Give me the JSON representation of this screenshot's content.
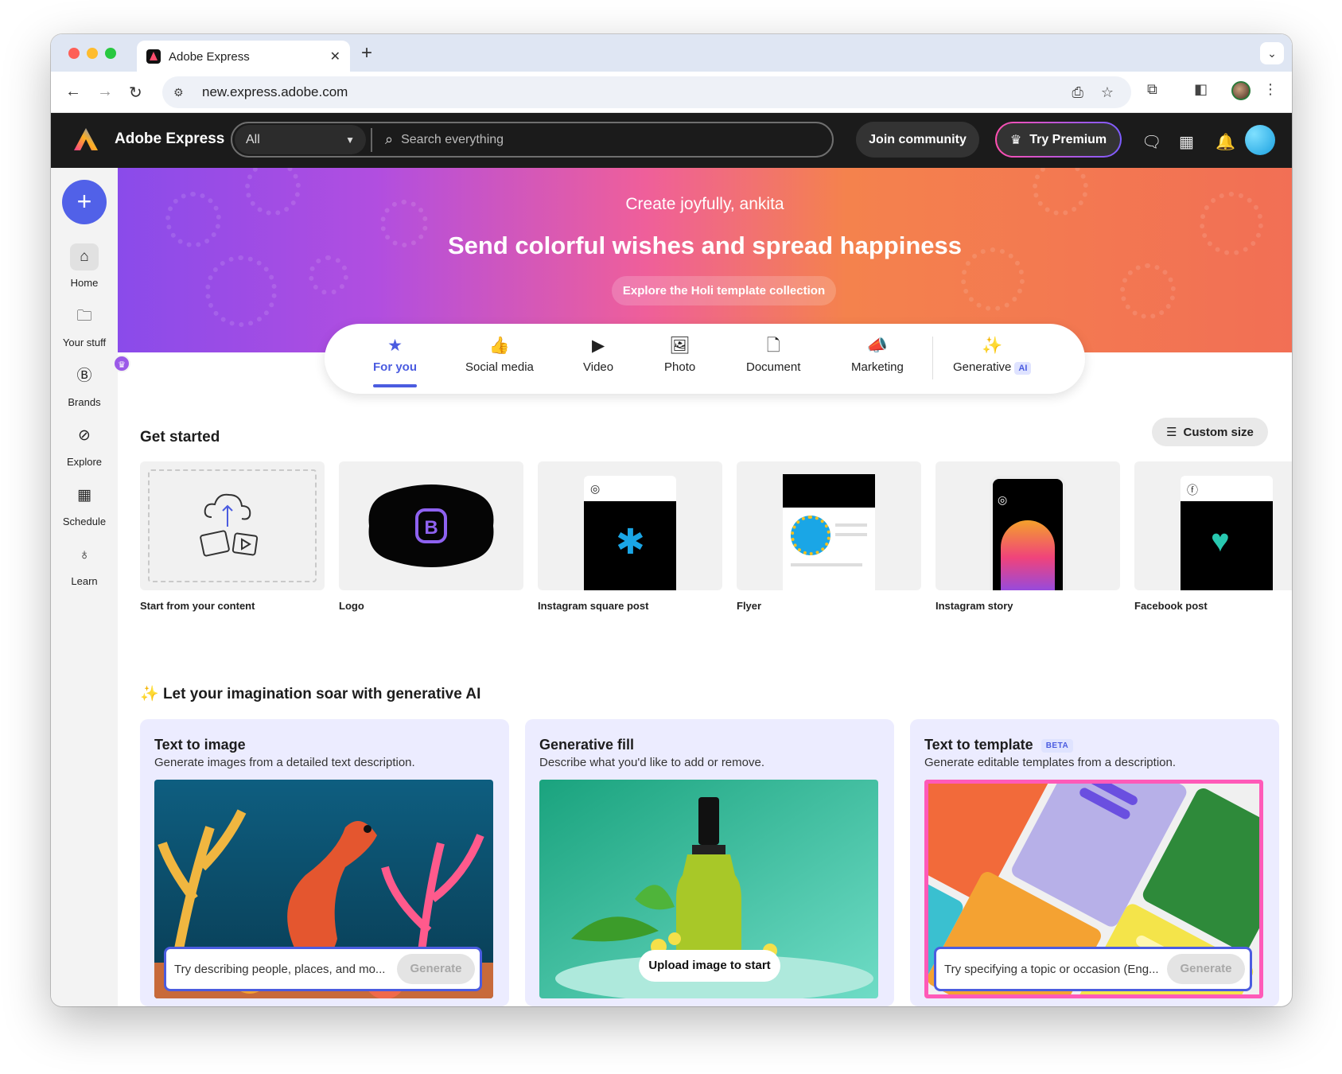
{
  "browser": {
    "tab_title": "Adobe Express",
    "tab_close": "✕",
    "new_tab": "+",
    "url": "new.express.adobe.com"
  },
  "header": {
    "brand": "Adobe Express",
    "search_scope": "All",
    "search_placeholder": "Search everything",
    "join_label": "Join community",
    "premium_label": "Try Premium"
  },
  "sidebar": {
    "create_label": "+",
    "items": [
      {
        "label": "Home",
        "icon": "home-icon"
      },
      {
        "label": "Your stuff",
        "icon": "folder-icon"
      },
      {
        "label": "Brands",
        "icon": "brands-icon"
      },
      {
        "label": "Explore",
        "icon": "compass-icon"
      },
      {
        "label": "Schedule",
        "icon": "calendar-icon"
      },
      {
        "label": "Learn",
        "icon": "lightbulb-icon"
      }
    ]
  },
  "hero": {
    "greeting": "Create joyfully, ankita",
    "headline": "Send colorful wishes and spread happiness",
    "cta": "Explore the Holi template collection",
    "colors": {
      "start": "#8a4bea",
      "mid": "#ef5f9a",
      "end": "#f26f55"
    }
  },
  "categories": [
    {
      "label": "For you",
      "icon": "star-icon",
      "active": true
    },
    {
      "label": "Social media",
      "icon": "thumbs-up-icon"
    },
    {
      "label": "Video",
      "icon": "play-icon"
    },
    {
      "label": "Photo",
      "icon": "image-icon"
    },
    {
      "label": "Document",
      "icon": "document-icon"
    },
    {
      "label": "Marketing",
      "icon": "megaphone-icon"
    },
    {
      "label": "Generative",
      "icon": "sparkle-icon",
      "badge": "AI"
    }
  ],
  "get_started": {
    "title": "Get started",
    "custom_size": "Custom size",
    "cards": [
      {
        "label": "Start from your content"
      },
      {
        "label": "Logo"
      },
      {
        "label": "Instagram square post"
      },
      {
        "label": "Flyer"
      },
      {
        "label": "Instagram story"
      },
      {
        "label": "Facebook post"
      }
    ]
  },
  "generative": {
    "title": "Let your imagination soar with generative AI",
    "cards": [
      {
        "title": "Text to image",
        "desc": "Generate images from a detailed text description.",
        "placeholder": "Try describing people, places, and mo...",
        "button": "Generate"
      },
      {
        "title": "Generative fill",
        "desc": "Describe what you'd like to add or remove.",
        "button": "Upload image to start"
      },
      {
        "title": "Text to template",
        "badge": "BETA",
        "desc": "Generate editable templates from a description.",
        "placeholder": "Try specifying a topic or occasion (Eng...",
        "button": "Generate"
      }
    ]
  },
  "accent_color": "#4b5ce0"
}
